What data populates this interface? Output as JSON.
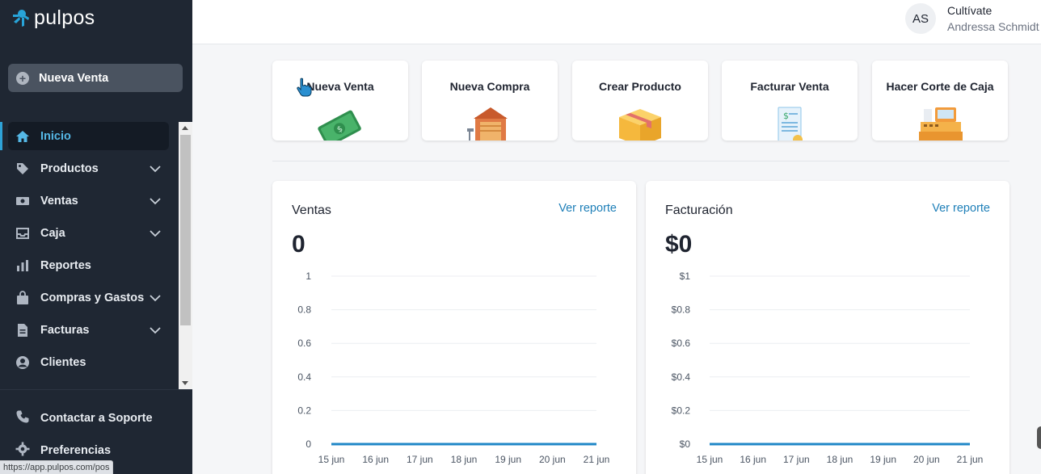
{
  "app": {
    "logo_text": "pulpos",
    "new_sale_button": "Nueva Venta",
    "status_url": "https://app.pulpos.com/pos"
  },
  "sidebar": {
    "items": [
      {
        "label": "Inicio",
        "icon": "home-icon",
        "active": true
      },
      {
        "label": "Productos",
        "icon": "tag-icon",
        "expandable": true
      },
      {
        "label": "Ventas",
        "icon": "cash-icon",
        "expandable": true
      },
      {
        "label": "Caja",
        "icon": "inbox-icon",
        "expandable": true
      },
      {
        "label": "Reportes",
        "icon": "bar-chart-icon"
      },
      {
        "label": "Compras y Gastos",
        "icon": "shopping-bag-icon",
        "expandable": true
      },
      {
        "label": "Facturas",
        "icon": "document-icon",
        "expandable": true
      },
      {
        "label": "Clientes",
        "icon": "user-circle-icon"
      }
    ],
    "bottom": [
      {
        "label": "Contactar a Soporte",
        "icon": "phone-icon"
      },
      {
        "label": "Preferencias",
        "icon": "gear-icon"
      }
    ]
  },
  "header": {
    "avatar_initials": "AS",
    "org_name": "Cultívate",
    "user_name": "Andressa Schmidt"
  },
  "quick_actions": [
    {
      "label": "Nueva Venta",
      "icon": "money-icon"
    },
    {
      "label": "Nueva Compra",
      "icon": "store-icon"
    },
    {
      "label": "Crear Producto",
      "icon": "box-icon"
    },
    {
      "label": "Facturar Venta",
      "icon": "invoice-icon"
    },
    {
      "label": "Hacer Corte de Caja",
      "icon": "cash-register-icon"
    }
  ],
  "cards": [
    {
      "title": "Ventas",
      "link": "Ver reporte",
      "total": "0"
    },
    {
      "title": "Facturación",
      "link": "Ver reporte",
      "total": "$0"
    }
  ],
  "colors": {
    "accent": "#1e7fb8",
    "line": "#1f87c7",
    "sidebar": "#1f2733"
  },
  "chart_data": [
    {
      "type": "line",
      "title": "Ventas",
      "x": [
        "15 jun",
        "16 jun",
        "17 jun",
        "18 jun",
        "19 jun",
        "20 jun",
        "21 jun"
      ],
      "y_ticks": [
        "0",
        "0.2",
        "0.4",
        "0.6",
        "0.8",
        "1"
      ],
      "ylim": [
        0,
        1
      ],
      "series": [
        {
          "values": [
            0,
            0,
            0,
            0,
            0,
            0,
            0
          ]
        }
      ]
    },
    {
      "type": "line",
      "title": "Facturación",
      "x": [
        "15 jun",
        "16 jun",
        "17 jun",
        "18 jun",
        "19 jun",
        "20 jun",
        "21 jun"
      ],
      "y_ticks": [
        "$0",
        "$0.2",
        "$0.4",
        "$0.6",
        "$0.8",
        "$1"
      ],
      "ylim": [
        0,
        1
      ],
      "series": [
        {
          "values": [
            0,
            0,
            0,
            0,
            0,
            0,
            0
          ]
        }
      ]
    }
  ]
}
